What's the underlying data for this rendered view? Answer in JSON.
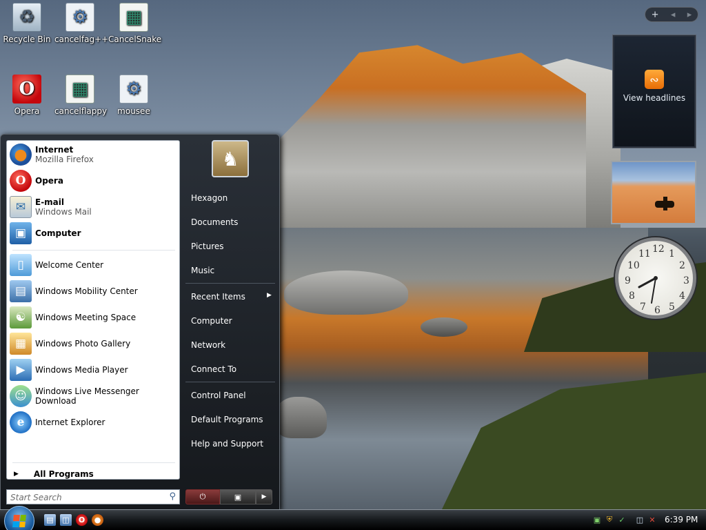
{
  "desktop": {
    "icons": [
      {
        "label": "Recycle Bin",
        "icon": "recycle-bin-icon"
      },
      {
        "label": "cancelfag++",
        "icon": "settings-app-icon"
      },
      {
        "label": "CancelSnake",
        "icon": "window-app-icon"
      },
      {
        "label": "Opera",
        "icon": "opera-icon"
      },
      {
        "label": "cancelflappy",
        "icon": "window-app-icon"
      },
      {
        "label": "mousee",
        "icon": "settings-app-icon"
      }
    ]
  },
  "sidebar": {
    "feed": {
      "label": "View headlines",
      "icon": "rss-icon"
    },
    "toolbar": {
      "add": "+",
      "prev": "◂",
      "next": "▸"
    },
    "clock": {
      "time": "6:39"
    }
  },
  "start_menu": {
    "pinned": [
      {
        "title": "Internet",
        "subtitle": "Mozilla Firefox",
        "icon": "firefox-icon"
      },
      {
        "title": "Opera",
        "subtitle": "",
        "icon": "opera-icon"
      },
      {
        "title": "E-mail",
        "subtitle": "Windows Mail",
        "icon": "mail-icon"
      },
      {
        "title": "Computer",
        "subtitle": "",
        "icon": "computer-icon"
      }
    ],
    "recent": [
      {
        "title": "Welcome Center",
        "icon": "welcome-center-icon"
      },
      {
        "title": "Windows Mobility Center",
        "icon": "mobility-center-icon"
      },
      {
        "title": "Windows Meeting Space",
        "icon": "meeting-space-icon"
      },
      {
        "title": "Windows Photo Gallery",
        "icon": "photo-gallery-icon"
      },
      {
        "title": "Windows Media Player",
        "icon": "media-player-icon"
      },
      {
        "title": "Windows Live Messenger Download",
        "icon": "messenger-icon"
      },
      {
        "title": "Internet Explorer",
        "icon": "internet-explorer-icon"
      }
    ],
    "all_programs": "All Programs",
    "search_placeholder": "Start Search",
    "right": {
      "user": "Hexagon",
      "group1": [
        "Documents",
        "Pictures",
        "Music"
      ],
      "group2": [
        "Recent Items",
        "Computer",
        "Network",
        "Connect To"
      ],
      "group3": [
        "Control Panel",
        "Default Programs",
        "Help and Support"
      ]
    }
  },
  "taskbar": {
    "time": "6:39 PM",
    "quick_launch": [
      "show-desktop-icon",
      "switch-windows-icon",
      "opera-icon",
      "firefox-icon"
    ],
    "tray": [
      "network-icon",
      "security-icon",
      "update-icon",
      "connection-icon",
      "volume-muted-icon"
    ]
  }
}
